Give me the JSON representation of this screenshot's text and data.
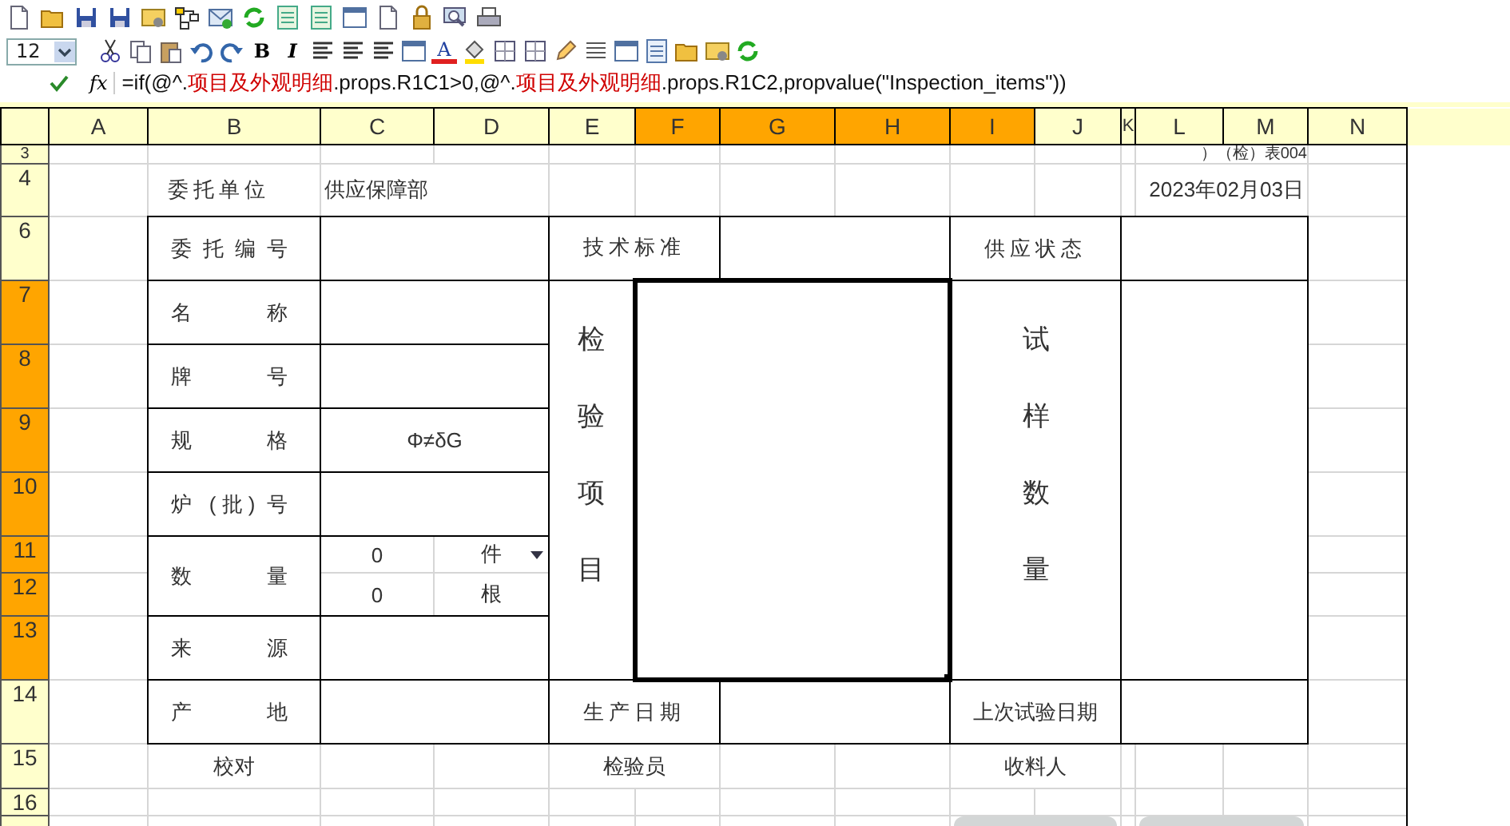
{
  "toolbar": {
    "font_size": "12",
    "bold": "B",
    "italic": "I",
    "font_color": "A"
  },
  "formula_bar": {
    "function_label": "fx",
    "segments": [
      {
        "kind": "plain",
        "text": "=if(@^."
      },
      {
        "kind": "name",
        "text": "项目及外观明细"
      },
      {
        "kind": "plain",
        "text": ".props.R1C1>0,@^."
      },
      {
        "kind": "name",
        "text": "项目及外观明细"
      },
      {
        "kind": "plain",
        "text": ".props.R1C2,propvalue(\"Inspection_items\"))"
      }
    ]
  },
  "columns": [
    {
      "label": "A",
      "selected": false
    },
    {
      "label": "B",
      "selected": false
    },
    {
      "label": "C",
      "selected": false
    },
    {
      "label": "D",
      "selected": false
    },
    {
      "label": "E",
      "selected": false
    },
    {
      "label": "F",
      "selected": true
    },
    {
      "label": "G",
      "selected": true
    },
    {
      "label": "H",
      "selected": true
    },
    {
      "label": "I",
      "selected": true
    },
    {
      "label": "J",
      "selected": false
    },
    {
      "label": "K",
      "selected": false
    },
    {
      "label": "L",
      "selected": false
    },
    {
      "label": "M",
      "selected": false
    },
    {
      "label": "N",
      "selected": false
    }
  ],
  "rows": [
    {
      "label": "3",
      "selected": false
    },
    {
      "label": "4",
      "selected": false
    },
    {
      "label": "6",
      "selected": false
    },
    {
      "label": "7",
      "selected": true
    },
    {
      "label": "8",
      "selected": true
    },
    {
      "label": "9",
      "selected": true
    },
    {
      "label": "10",
      "selected": true
    },
    {
      "label": "11",
      "selected": true
    },
    {
      "label": "12",
      "selected": true
    },
    {
      "label": "13",
      "selected": true
    },
    {
      "label": "14",
      "selected": false
    },
    {
      "label": "15",
      "selected": false
    },
    {
      "label": "16",
      "selected": false
    },
    {
      "selected": false
    }
  ],
  "form": {
    "form_number": "）（检）表004",
    "client_unit": {
      "label": "委托单位",
      "value": "供应保障部"
    },
    "date": "2023年02月03日",
    "commission_no": {
      "label": "委托编号"
    },
    "tech_standard": {
      "label": "技术标准"
    },
    "supply_state": {
      "label": "供应状态"
    },
    "fields": [
      {
        "label": "名称"
      },
      {
        "label": "牌号"
      },
      {
        "label": "规格",
        "value": "Φ≠δG"
      },
      {
        "label": "炉 (批) 号"
      }
    ],
    "quantity": {
      "label": "数量",
      "rows": [
        {
          "value": "0",
          "unit": "件",
          "dropdown": true
        },
        {
          "value": "0",
          "unit": "根",
          "dropdown": false
        }
      ]
    },
    "source": {
      "label": "来源"
    },
    "origin": {
      "label": "产地"
    },
    "production_date": {
      "label": "生产日期"
    },
    "last_test_date": {
      "label": "上次试验日期"
    },
    "inspection_items": {
      "label": "检验项目"
    },
    "sample_qty": {
      "label": "试样数量"
    },
    "signatures": [
      {
        "label": "校对"
      },
      {
        "label": "检验员"
      },
      {
        "label": "收料人"
      }
    ]
  }
}
